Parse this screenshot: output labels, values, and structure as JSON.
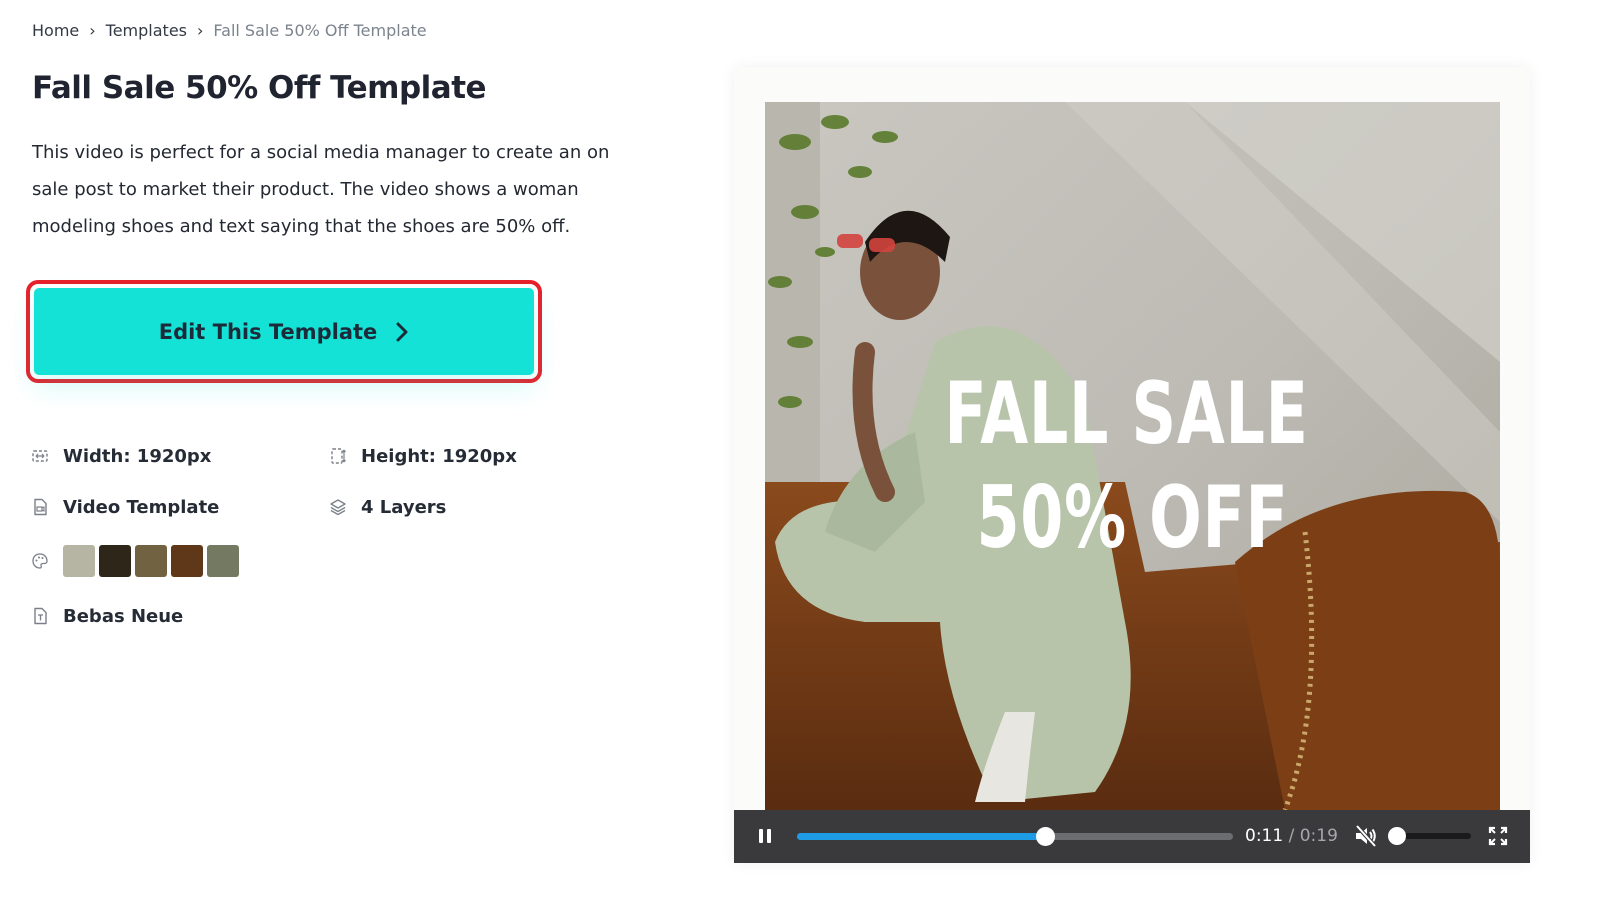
{
  "breadcrumb": {
    "items": [
      "Home",
      "Templates"
    ],
    "separator": "›",
    "current": "Fall Sale 50% Off Template"
  },
  "page_title": "Fall Sale 50% Off Template",
  "description": "This video is perfect for a social media manager to create an on sale post to market their product. The video shows a woman modeling shoes and text saying that the shoes are 50% off.",
  "cta": {
    "label": "Edit This Template",
    "icon": "chevron-right-icon",
    "color": "#15e2d6",
    "highlight_color": "#e8202a"
  },
  "specs": {
    "width": "Width: 1920px",
    "height": "Height: 1920px",
    "type": "Video Template",
    "layers": "4 Layers",
    "font": "Bebas Neue"
  },
  "palette": [
    "#b6b4a2",
    "#2e2719",
    "#716342",
    "#5f3819",
    "#747a62"
  ],
  "video": {
    "overlay_line1": "FALL SALE",
    "overlay_line2": "50% OFF",
    "current_time": "0:11",
    "time_separator": " / ",
    "duration": "0:19",
    "progress_fraction": 0.568,
    "volume_fraction": 0.0,
    "muted": true,
    "playing": true
  }
}
